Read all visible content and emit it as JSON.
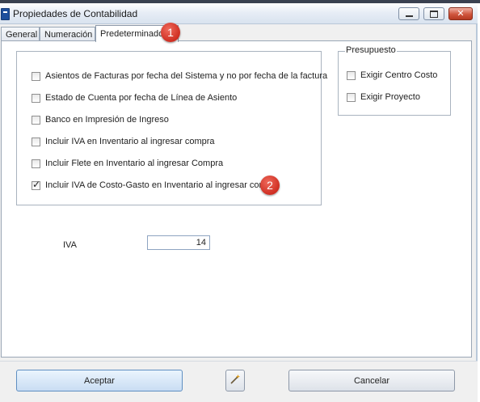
{
  "window": {
    "title": "Propiedades de Contabilidad"
  },
  "tabs": [
    {
      "label": "General"
    },
    {
      "label": "Numeración"
    },
    {
      "label": "Predeterminados"
    }
  ],
  "options": [
    {
      "label": "Asientos de Facturas por fecha del Sistema y no por fecha de la factura",
      "checked": false
    },
    {
      "label": "Estado de Cuenta por fecha de Línea de Asiento",
      "checked": false
    },
    {
      "label": "Banco en Impresión de Ingreso",
      "checked": false
    },
    {
      "label": "Incluir IVA en Inventario al ingresar compra",
      "checked": false
    },
    {
      "label": "Incluir Flete en Inventario al ingresar Compra",
      "checked": false
    },
    {
      "label": "Incluir IVA de Costo-Gasto en Inventario al ingresar compra",
      "checked": true
    }
  ],
  "presupuesto": {
    "legend": "Presupuesto",
    "items": [
      {
        "label": "Exigir Centro Costo",
        "checked": false
      },
      {
        "label": "Exigir Proyecto",
        "checked": false
      }
    ]
  },
  "iva": {
    "label": "IVA",
    "value": "14"
  },
  "buttons": {
    "accept": "Aceptar",
    "cancel": "Cancelar"
  },
  "annotations": [
    "1",
    "2"
  ],
  "icons": {
    "app": "ledger-app-icon",
    "wand": "magic-wand-icon"
  }
}
